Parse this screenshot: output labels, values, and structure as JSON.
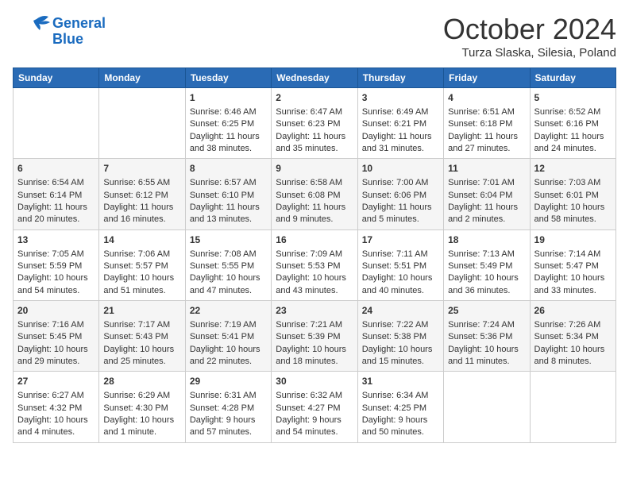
{
  "logo": {
    "line1": "General",
    "line2": "Blue"
  },
  "title": "October 2024",
  "location": "Turza Slaska, Silesia, Poland",
  "days_of_week": [
    "Sunday",
    "Monday",
    "Tuesday",
    "Wednesday",
    "Thursday",
    "Friday",
    "Saturday"
  ],
  "weeks": [
    [
      {
        "day": "",
        "content": ""
      },
      {
        "day": "",
        "content": ""
      },
      {
        "day": "1",
        "content": "Sunrise: 6:46 AM\nSunset: 6:25 PM\nDaylight: 11 hours and 38 minutes."
      },
      {
        "day": "2",
        "content": "Sunrise: 6:47 AM\nSunset: 6:23 PM\nDaylight: 11 hours and 35 minutes."
      },
      {
        "day": "3",
        "content": "Sunrise: 6:49 AM\nSunset: 6:21 PM\nDaylight: 11 hours and 31 minutes."
      },
      {
        "day": "4",
        "content": "Sunrise: 6:51 AM\nSunset: 6:18 PM\nDaylight: 11 hours and 27 minutes."
      },
      {
        "day": "5",
        "content": "Sunrise: 6:52 AM\nSunset: 6:16 PM\nDaylight: 11 hours and 24 minutes."
      }
    ],
    [
      {
        "day": "6",
        "content": "Sunrise: 6:54 AM\nSunset: 6:14 PM\nDaylight: 11 hours and 20 minutes."
      },
      {
        "day": "7",
        "content": "Sunrise: 6:55 AM\nSunset: 6:12 PM\nDaylight: 11 hours and 16 minutes."
      },
      {
        "day": "8",
        "content": "Sunrise: 6:57 AM\nSunset: 6:10 PM\nDaylight: 11 hours and 13 minutes."
      },
      {
        "day": "9",
        "content": "Sunrise: 6:58 AM\nSunset: 6:08 PM\nDaylight: 11 hours and 9 minutes."
      },
      {
        "day": "10",
        "content": "Sunrise: 7:00 AM\nSunset: 6:06 PM\nDaylight: 11 hours and 5 minutes."
      },
      {
        "day": "11",
        "content": "Sunrise: 7:01 AM\nSunset: 6:04 PM\nDaylight: 11 hours and 2 minutes."
      },
      {
        "day": "12",
        "content": "Sunrise: 7:03 AM\nSunset: 6:01 PM\nDaylight: 10 hours and 58 minutes."
      }
    ],
    [
      {
        "day": "13",
        "content": "Sunrise: 7:05 AM\nSunset: 5:59 PM\nDaylight: 10 hours and 54 minutes."
      },
      {
        "day": "14",
        "content": "Sunrise: 7:06 AM\nSunset: 5:57 PM\nDaylight: 10 hours and 51 minutes."
      },
      {
        "day": "15",
        "content": "Sunrise: 7:08 AM\nSunset: 5:55 PM\nDaylight: 10 hours and 47 minutes."
      },
      {
        "day": "16",
        "content": "Sunrise: 7:09 AM\nSunset: 5:53 PM\nDaylight: 10 hours and 43 minutes."
      },
      {
        "day": "17",
        "content": "Sunrise: 7:11 AM\nSunset: 5:51 PM\nDaylight: 10 hours and 40 minutes."
      },
      {
        "day": "18",
        "content": "Sunrise: 7:13 AM\nSunset: 5:49 PM\nDaylight: 10 hours and 36 minutes."
      },
      {
        "day": "19",
        "content": "Sunrise: 7:14 AM\nSunset: 5:47 PM\nDaylight: 10 hours and 33 minutes."
      }
    ],
    [
      {
        "day": "20",
        "content": "Sunrise: 7:16 AM\nSunset: 5:45 PM\nDaylight: 10 hours and 29 minutes."
      },
      {
        "day": "21",
        "content": "Sunrise: 7:17 AM\nSunset: 5:43 PM\nDaylight: 10 hours and 25 minutes."
      },
      {
        "day": "22",
        "content": "Sunrise: 7:19 AM\nSunset: 5:41 PM\nDaylight: 10 hours and 22 minutes."
      },
      {
        "day": "23",
        "content": "Sunrise: 7:21 AM\nSunset: 5:39 PM\nDaylight: 10 hours and 18 minutes."
      },
      {
        "day": "24",
        "content": "Sunrise: 7:22 AM\nSunset: 5:38 PM\nDaylight: 10 hours and 15 minutes."
      },
      {
        "day": "25",
        "content": "Sunrise: 7:24 AM\nSunset: 5:36 PM\nDaylight: 10 hours and 11 minutes."
      },
      {
        "day": "26",
        "content": "Sunrise: 7:26 AM\nSunset: 5:34 PM\nDaylight: 10 hours and 8 minutes."
      }
    ],
    [
      {
        "day": "27",
        "content": "Sunrise: 6:27 AM\nSunset: 4:32 PM\nDaylight: 10 hours and 4 minutes."
      },
      {
        "day": "28",
        "content": "Sunrise: 6:29 AM\nSunset: 4:30 PM\nDaylight: 10 hours and 1 minute."
      },
      {
        "day": "29",
        "content": "Sunrise: 6:31 AM\nSunset: 4:28 PM\nDaylight: 9 hours and 57 minutes."
      },
      {
        "day": "30",
        "content": "Sunrise: 6:32 AM\nSunset: 4:27 PM\nDaylight: 9 hours and 54 minutes."
      },
      {
        "day": "31",
        "content": "Sunrise: 6:34 AM\nSunset: 4:25 PM\nDaylight: 9 hours and 50 minutes."
      },
      {
        "day": "",
        "content": ""
      },
      {
        "day": "",
        "content": ""
      }
    ]
  ]
}
